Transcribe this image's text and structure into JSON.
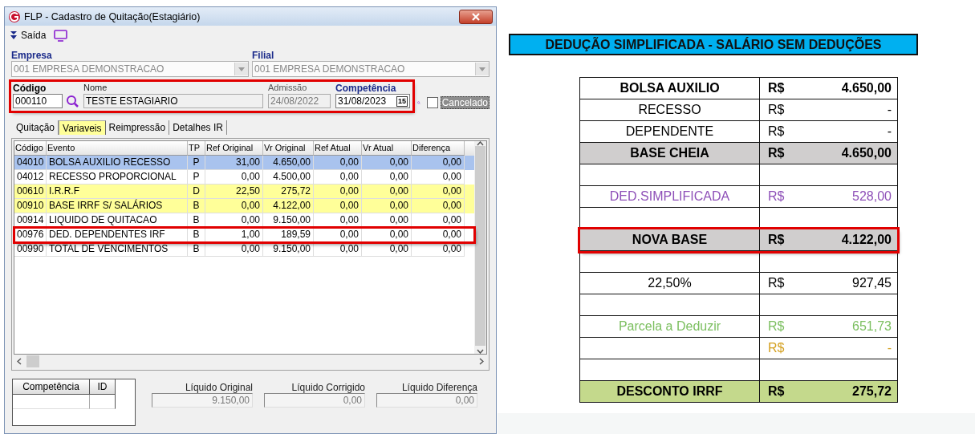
{
  "window": {
    "title": "FLP - Cadastro de Quitação(Estagiário)"
  },
  "toolbar": {
    "exit_label": "Saída"
  },
  "selectors": [
    {
      "label": "Empresa",
      "value": "001 EMPRESA DEMONSTRACAO",
      "disabled": true
    },
    {
      "label": "Filial",
      "value": "001 EMPRESA DEMONSTRACAO",
      "disabled": true
    }
  ],
  "employee_group": {
    "highlighted": true,
    "fields": [
      {
        "kind": "lookup",
        "label": "Código",
        "value": "000110"
      },
      {
        "kind": "text",
        "label": "Nome",
        "value": "TESTE ESTAGIARIO"
      },
      {
        "kind": "readonly",
        "label": "Admissão",
        "value": "24/08/2022"
      },
      {
        "kind": "date",
        "label": "Competência",
        "value": "31/08/2023",
        "button": "15"
      }
    ]
  },
  "cancelado": {
    "label": "Cancelado",
    "checked": false
  },
  "tabs": [
    {
      "label": "Quitação",
      "selected": false
    },
    {
      "label": "Variaveis",
      "selected": true
    },
    {
      "label": "Reimpressão",
      "selected": false
    },
    {
      "label": "Detalhes IR",
      "selected": false
    }
  ],
  "grid": {
    "columns": [
      "Código",
      "Evento",
      "TP",
      "Ref Original",
      "Vr Original",
      "Ref Atual",
      "Vr Atual",
      "Diferença"
    ],
    "rows": [
      {
        "selected": true,
        "framed": false,
        "cells": [
          "04010",
          "BOLSA AUXILIO RECESSO",
          "P",
          "31,00",
          "4.650,00",
          "0,00",
          "0,00",
          "0,00"
        ]
      },
      {
        "selected": false,
        "framed": false,
        "color": "#ffffff",
        "cells": [
          "04012",
          "RECESSO PROPORCIONAL",
          "P",
          "0,00",
          "4.500,00",
          "0,00",
          "0,00",
          "0,00"
        ]
      },
      {
        "selected": false,
        "framed": false,
        "color": "#ffff99",
        "cells": [
          "00610",
          "I.R.R.F",
          "D",
          "22,50",
          "275,72",
          "0,00",
          "0,00",
          "0,00"
        ]
      },
      {
        "selected": false,
        "framed": false,
        "color": "#ffff99",
        "cells": [
          "00910",
          "BASE IRRF S/ SALÁRIOS",
          "B",
          "0,00",
          "4.122,00",
          "0,00",
          "0,00",
          "0,00"
        ]
      },
      {
        "selected": false,
        "framed": false,
        "color": "#ffffff",
        "cells": [
          "00914",
          "LIQUIDO DE QUITACAO",
          "B",
          "0,00",
          "9.150,00",
          "0,00",
          "0,00",
          "0,00"
        ]
      },
      {
        "selected": false,
        "framed": true,
        "color": "#ffffff",
        "cells": [
          "00976",
          "DED. DEPENDENTES IRF",
          "B",
          "1,00",
          "189,59",
          "0,00",
          "0,00",
          "0,00"
        ]
      },
      {
        "selected": false,
        "framed": false,
        "color": "#ffffff",
        "cells": [
          "00990",
          "TOTAL DE VENCIMENTOS",
          "B",
          "0,00",
          "9.150,00",
          "0,00",
          "0,00",
          "0,00"
        ]
      }
    ]
  },
  "summary_table": {
    "columns": [
      "Competência",
      "ID"
    ]
  },
  "totals": [
    {
      "label": "Líquido Original",
      "value": "9.150,00"
    },
    {
      "label": "Líquido Corrigido",
      "value": "0,00"
    },
    {
      "label": "Líquido Diferença",
      "value": "0,00"
    }
  ],
  "sheet": {
    "title": "DEDUÇÃO SIMPLIFICADA - SALÁRIO SEM DEDUÇÕES",
    "rows": [
      {
        "kind": "bold",
        "label": "BOLSA AUXILIO",
        "currency": "R$",
        "value": "4.650,00",
        "framed": false
      },
      {
        "kind": "normal",
        "label": "RECESSO",
        "currency": "R$",
        "value": "-",
        "framed": false
      },
      {
        "kind": "normal",
        "label": "DEPENDENTE",
        "currency": "R$",
        "value": "-",
        "framed": false
      },
      {
        "kind": "subtotal",
        "label": "BASE CHEIA",
        "currency": "R$",
        "value": "4.650,00",
        "framed": false
      },
      {
        "kind": "blank",
        "framed": false
      },
      {
        "kind": "deduction",
        "label": "DED.SIMPLIFICADA",
        "currency": "R$",
        "value": "528,00",
        "framed": false
      },
      {
        "kind": "blank",
        "framed": false
      },
      {
        "kind": "subtotal",
        "label": "NOVA BASE",
        "currency": "R$",
        "value": "4.122,00",
        "framed": true
      },
      {
        "kind": "blank",
        "framed": false
      },
      {
        "kind": "normal",
        "label": "22,50%",
        "currency": "R$",
        "value": "927,45",
        "framed": false
      },
      {
        "kind": "blank",
        "framed": false
      },
      {
        "kind": "parcel",
        "label": "Parcela a Deduzir",
        "currency": "R$",
        "value": "651,73",
        "framed": false
      },
      {
        "kind": "other",
        "currency": "R$",
        "value": "-",
        "framed": false
      },
      {
        "kind": "blank",
        "framed": false
      },
      {
        "kind": "total",
        "label": "DESCONTO IRRF",
        "currency": "R$",
        "value": "275,72",
        "framed": false
      }
    ]
  }
}
